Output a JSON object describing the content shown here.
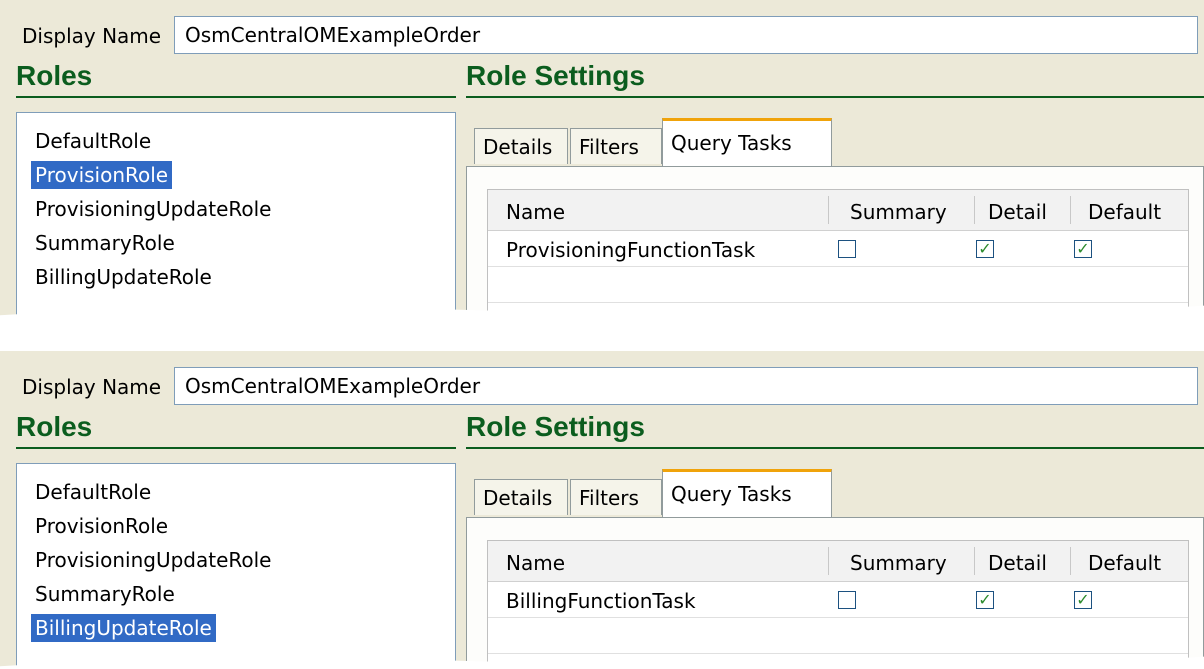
{
  "panels": [
    {
      "display_name_label": "Display Name",
      "display_name_value": "OsmCentralOMExampleOrder",
      "roles_title": "Roles",
      "settings_title": "Role Settings",
      "roles": [
        {
          "label": "DefaultRole",
          "selected": false
        },
        {
          "label": "ProvisionRole",
          "selected": true
        },
        {
          "label": "ProvisioningUpdateRole",
          "selected": false
        },
        {
          "label": "SummaryRole",
          "selected": false
        },
        {
          "label": "BillingUpdateRole",
          "selected": false
        }
      ],
      "tabs": [
        "Details",
        "Filters",
        "Query Tasks"
      ],
      "active_tab": "Query Tasks",
      "table": {
        "headers": [
          "Name",
          "Summary",
          "Detail",
          "Default"
        ],
        "rows": [
          {
            "name": "ProvisioningFunctionTask",
            "summary": false,
            "detail": true,
            "default": true
          }
        ]
      }
    },
    {
      "display_name_label": "Display Name",
      "display_name_value": "OsmCentralOMExampleOrder",
      "roles_title": "Roles",
      "settings_title": "Role Settings",
      "roles": [
        {
          "label": "DefaultRole",
          "selected": false
        },
        {
          "label": "ProvisionRole",
          "selected": false
        },
        {
          "label": "ProvisioningUpdateRole",
          "selected": false
        },
        {
          "label": "SummaryRole",
          "selected": false
        },
        {
          "label": "BillingUpdateRole",
          "selected": true
        }
      ],
      "tabs": [
        "Details",
        "Filters",
        "Query Tasks"
      ],
      "active_tab": "Query Tasks",
      "table": {
        "headers": [
          "Name",
          "Summary",
          "Detail",
          "Default"
        ],
        "rows": [
          {
            "name": "BillingFunctionTask",
            "summary": false,
            "detail": true,
            "default": true
          }
        ]
      }
    }
  ],
  "colors": {
    "section_title": "#0b5d1e",
    "selection": "#316ac5",
    "active_tab_accent": "#f0a30a",
    "panel_bg": "#ece9d8"
  },
  "icons": {
    "checked": "checkbox-checked-icon",
    "unchecked": "checkbox-unchecked-icon"
  }
}
